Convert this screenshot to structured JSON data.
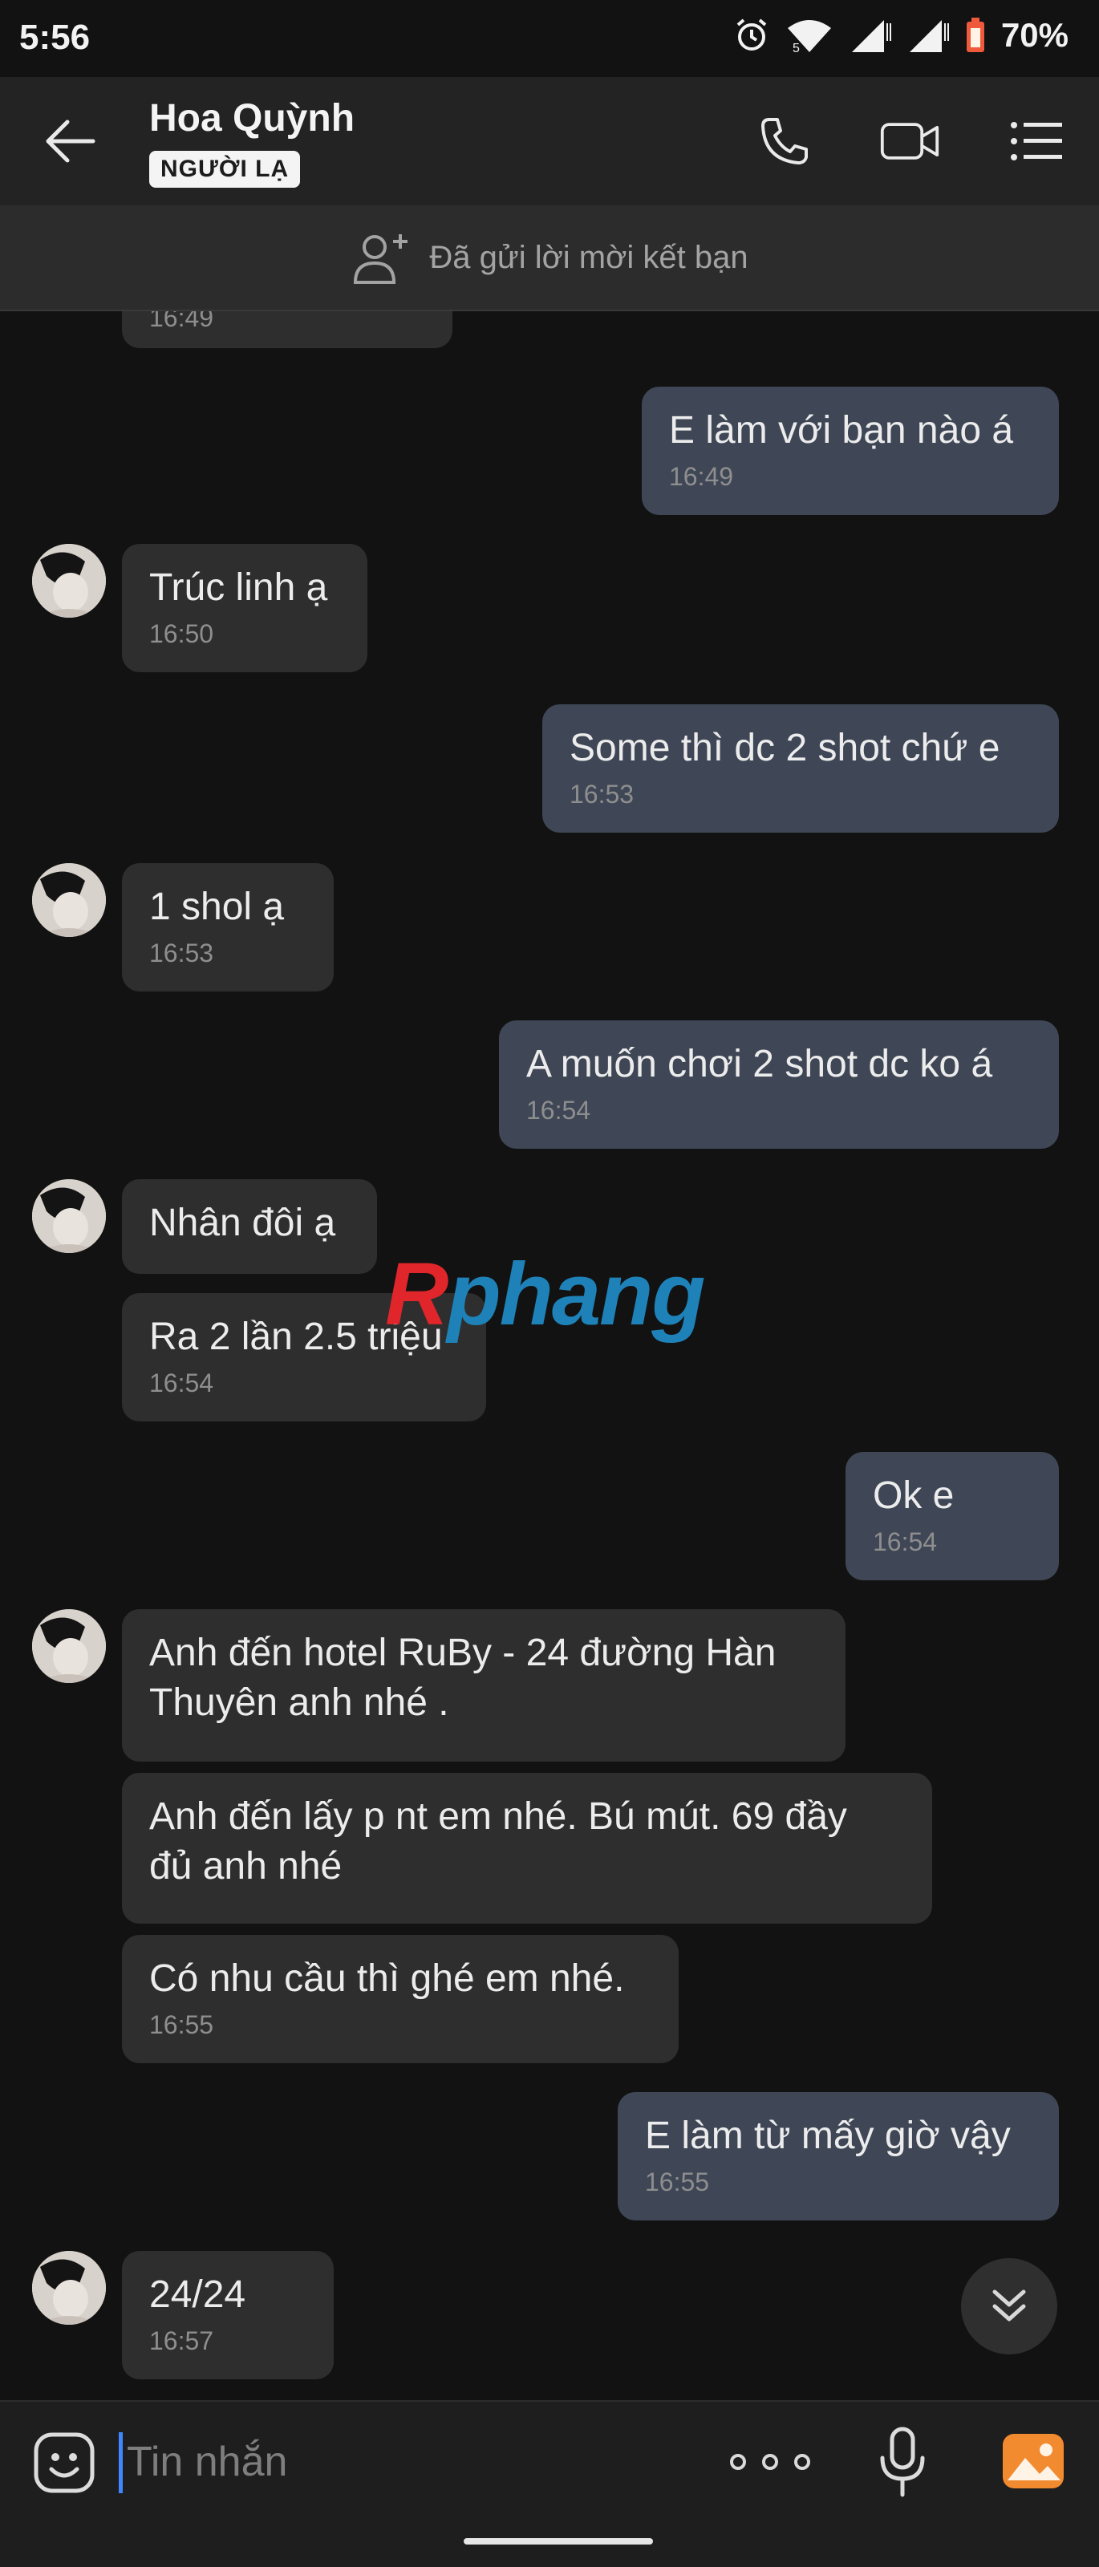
{
  "status_bar": {
    "time": "5:56",
    "battery": "70%",
    "network": "5"
  },
  "header": {
    "contact_name": "Hoa Quỳnh",
    "badge": "NGƯỜI LẠ"
  },
  "friend_banner": {
    "text": "Đã gửi lời mời kết bạn"
  },
  "messages": [
    {
      "dir": "in",
      "time": "16:49"
    },
    {
      "dir": "out",
      "text": "E làm với bạn nào á",
      "time": "16:49"
    },
    {
      "dir": "in",
      "text": "Trúc linh ạ",
      "time": "16:50"
    },
    {
      "dir": "out",
      "text": "Some thì dc 2 shot chứ e",
      "time": "16:53"
    },
    {
      "dir": "in",
      "text": "1 shol ạ",
      "time": "16:53"
    },
    {
      "dir": "out",
      "text": "A muốn chơi 2 shot dc ko á",
      "time": "16:54"
    },
    {
      "dir": "in",
      "text": "Nhân đôi ạ"
    },
    {
      "dir": "in",
      "text": "Ra 2 lần 2.5 triệu",
      "time": "16:54"
    },
    {
      "dir": "out",
      "text": "Ok e",
      "time": "16:54"
    },
    {
      "dir": "in",
      "lines": [
        "Anh đến hotel RuBy - 24 đường Hàn",
        "Thuyên anh nhé ."
      ]
    },
    {
      "dir": "in",
      "lines": [
        "Anh đến lấy p nt em nhé. Bú mút. 69 đầy",
        "đủ anh nhé"
      ]
    },
    {
      "dir": "in",
      "text": "Có nhu cầu thì ghé em nhé.",
      "time": "16:55"
    },
    {
      "dir": "out",
      "text": "E làm từ mấy giờ vậy",
      "time": "16:55"
    },
    {
      "dir": "in",
      "text": "24/24",
      "time": "16:57"
    }
  ],
  "watermark": {
    "first": "R",
    "rest": "phang"
  },
  "composer": {
    "placeholder": "Tin nhắn"
  },
  "colors": {
    "incoming_bubble": "#2e2e2e",
    "outgoing_bubble": "#3f4756",
    "header": "#232323",
    "background": "#121212",
    "accent_caret": "#3f86ff",
    "gallery_icon": "#f28a30"
  }
}
